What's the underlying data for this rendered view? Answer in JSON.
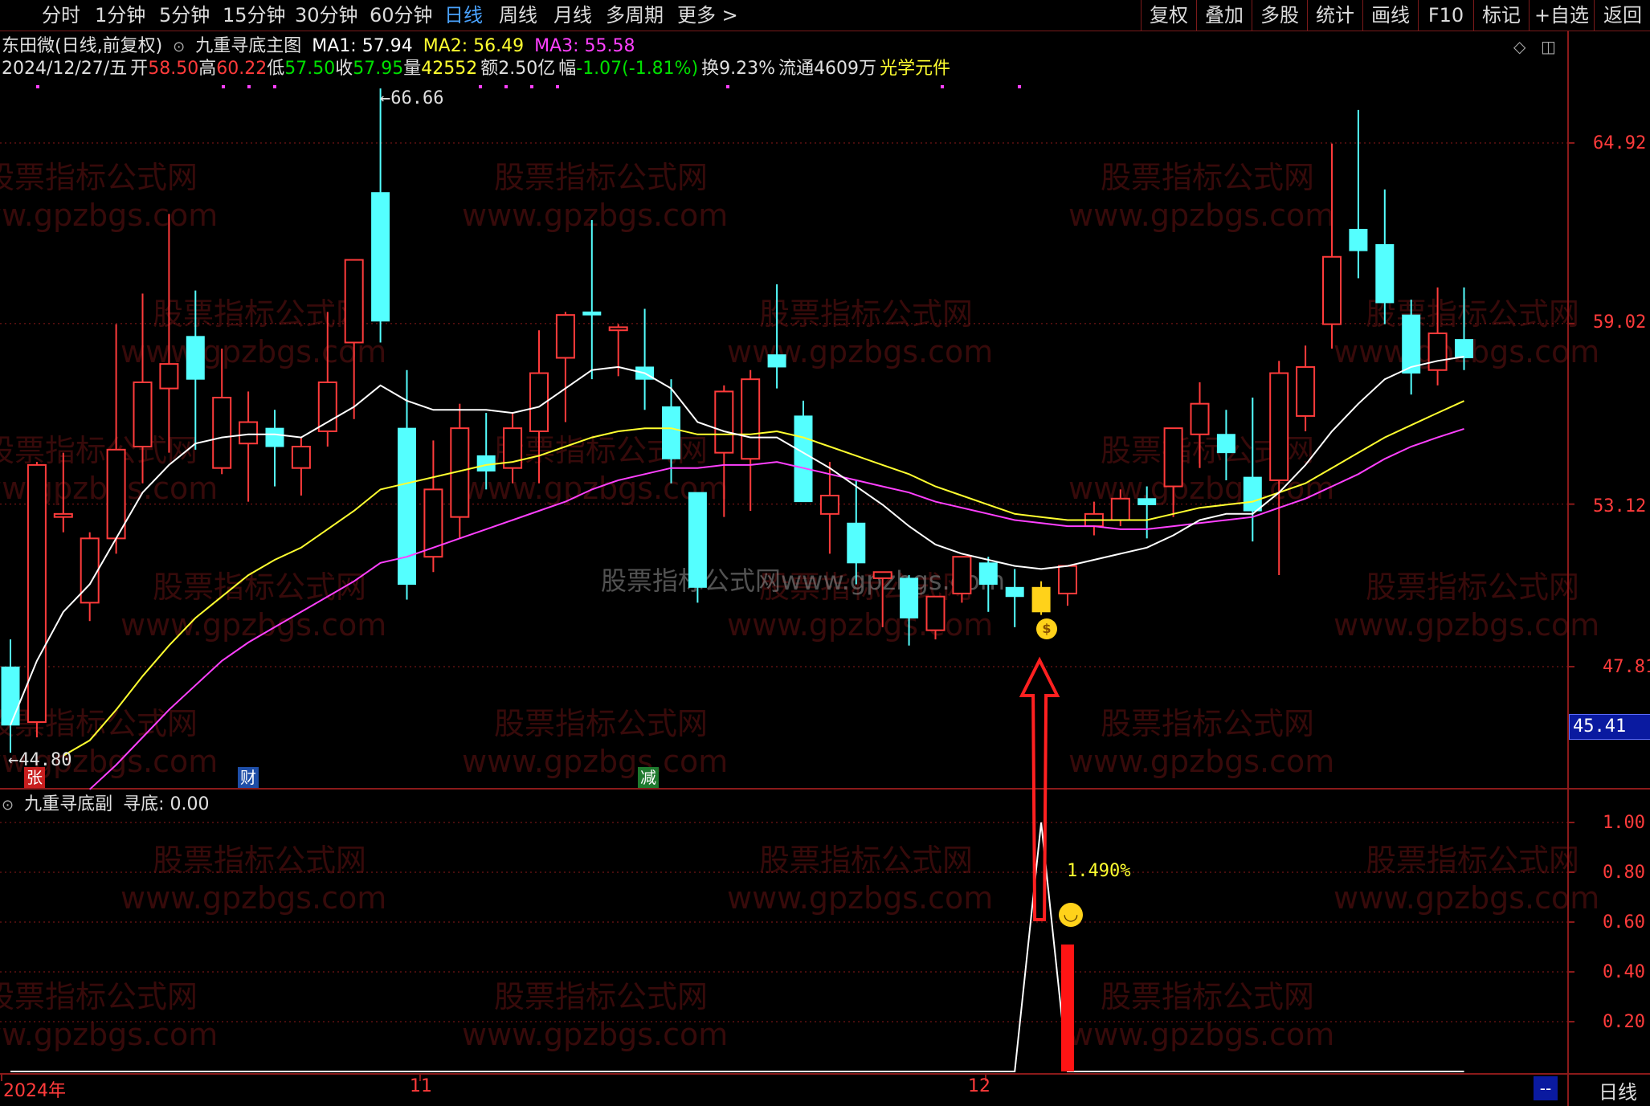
{
  "toolbar": {
    "periods": [
      "分时",
      "1分钟",
      "5分钟",
      "15分钟",
      "30分钟",
      "60分钟",
      "日线",
      "周线",
      "月线",
      "多周期",
      "更多 >"
    ],
    "active_period": "日线",
    "right_buttons": [
      "复权",
      "叠加",
      "多股",
      "统计",
      "画线",
      "F10",
      "标记",
      "+自选",
      "返回"
    ]
  },
  "main_header": {
    "stock": "东田微(日线,前复权)",
    "indicator": "九重寻底主图",
    "ma1": "MA1: 57.94",
    "ma2": "MA2: 56.49",
    "ma3": "MA3: 55.58"
  },
  "quote_line": {
    "date": "2024/12/27/五",
    "open_label": "开",
    "open": "58.50",
    "high_label": "高",
    "high": "60.22",
    "low_label": "低",
    "low": "57.50",
    "close_label": "收",
    "close": "57.95",
    "volume_label": "量",
    "volume": "42552",
    "amount": "额2.50亿",
    "change_label": "幅",
    "change": "-1.07(-1.81%)",
    "turnover": "换9.23%",
    "float_shares": "流通4609万",
    "concept": "光学元件"
  },
  "price_axis": [
    "64.92",
    "59.02",
    "53.12",
    "47.81"
  ],
  "current_price_tag": "45.41",
  "high_marker": "66.66",
  "low_marker": "44.80",
  "event_tags": [
    {
      "text": "张",
      "color": "#c81e1e"
    },
    {
      "text": "财",
      "color": "#1e4ea8"
    },
    {
      "text": "减",
      "color": "#1e7a2e"
    }
  ],
  "sub_header": {
    "indicator": "九重寻底副",
    "value": "寻底: 0.00"
  },
  "sub_axis": [
    "1.00",
    "0.80",
    "0.60",
    "0.40",
    "0.20"
  ],
  "signal_percent": "1.490%",
  "date_axis": [
    "2024年",
    "11",
    "12"
  ],
  "period_label": "日线",
  "scroll_label": "--",
  "watermarks": {
    "cn": "股票指标公式网",
    "url": "www.gpzbgs.com",
    "center": "股票指标公式网www.gpzbgs.com"
  },
  "colors": {
    "up": "#ff3b3b",
    "down": "#54ffff",
    "ma1": "#ffffff",
    "ma2": "#ffff30",
    "ma3": "#ff40ff",
    "grid": "#8b1a1a",
    "signal": "#ff1414",
    "arrow": "#ff2020"
  },
  "chart_data": {
    "type": "candlestick",
    "price_axis_ticks": [
      64.92,
      59.02,
      53.12,
      47.81
    ],
    "extremes": {
      "high": 66.66,
      "low": 44.8
    },
    "candles": [
      {
        "o": 47.8,
        "h": 48.7,
        "c": 45.9,
        "l": 45.0
      },
      {
        "o": 46.0,
        "h": 54.5,
        "c": 54.4,
        "l": 45.5
      },
      {
        "o": 52.7,
        "h": 54.8,
        "c": 52.8,
        "l": 52.2
      },
      {
        "o": 49.9,
        "h": 52.2,
        "c": 52.0,
        "l": 49.3
      },
      {
        "o": 52.0,
        "h": 59.0,
        "c": 54.9,
        "l": 51.5
      },
      {
        "o": 55.0,
        "h": 60.0,
        "c": 57.1,
        "l": 53.8
      },
      {
        "o": 56.9,
        "h": 62.6,
        "c": 57.7,
        "l": 54.8
      },
      {
        "o": 58.6,
        "h": 60.1,
        "c": 57.2,
        "l": 54.9
      },
      {
        "o": 54.3,
        "h": 58.2,
        "c": 56.6,
        "l": 54.1
      },
      {
        "o": 55.1,
        "h": 56.8,
        "c": 55.8,
        "l": 53.2
      },
      {
        "o": 55.6,
        "h": 56.2,
        "c": 55.0,
        "l": 53.7
      },
      {
        "o": 54.3,
        "h": 55.3,
        "c": 55.0,
        "l": 53.4
      },
      {
        "o": 55.5,
        "h": 59.4,
        "c": 57.1,
        "l": 55.0
      },
      {
        "o": 58.4,
        "h": 61.0,
        "c": 61.1,
        "l": 55.9
      },
      {
        "o": 63.3,
        "h": 66.7,
        "c": 59.1,
        "l": 58.4
      },
      {
        "o": 55.6,
        "h": 57.5,
        "c": 50.5,
        "l": 50.0
      },
      {
        "o": 51.4,
        "h": 55.2,
        "c": 53.6,
        "l": 50.9
      },
      {
        "o": 52.7,
        "h": 56.4,
        "c": 55.6,
        "l": 52.0
      },
      {
        "o": 54.7,
        "h": 56.1,
        "c": 54.2,
        "l": 53.6
      },
      {
        "o": 54.3,
        "h": 56.1,
        "c": 55.6,
        "l": 53.8
      },
      {
        "o": 55.5,
        "h": 58.8,
        "c": 57.4,
        "l": 53.8
      },
      {
        "o": 57.9,
        "h": 59.4,
        "c": 59.3,
        "l": 55.8
      },
      {
        "o": 59.4,
        "h": 62.4,
        "c": 59.3,
        "l": 57.2
      },
      {
        "o": 58.8,
        "h": 59.0,
        "c": 58.9,
        "l": 57.3
      },
      {
        "o": 57.6,
        "h": 59.5,
        "c": 57.2,
        "l": 56.2
      },
      {
        "o": 56.3,
        "h": 57.2,
        "c": 54.6,
        "l": 53.8
      },
      {
        "o": 53.5,
        "h": 53.5,
        "c": 50.4,
        "l": 49.9
      },
      {
        "o": 54.8,
        "h": 57.0,
        "c": 56.8,
        "l": 52.7
      },
      {
        "o": 54.6,
        "h": 57.5,
        "c": 57.2,
        "l": 52.9
      },
      {
        "o": 58.0,
        "h": 60.3,
        "c": 57.6,
        "l": 56.9
      },
      {
        "o": 56.0,
        "h": 56.5,
        "c": 53.2,
        "l": 53.2
      },
      {
        "o": 52.8,
        "h": 54.5,
        "c": 53.4,
        "l": 51.5
      },
      {
        "o": 52.5,
        "h": 53.9,
        "c": 51.2,
        "l": 50.5
      },
      {
        "o": 50.7,
        "h": 50.7,
        "c": 50.9,
        "l": 49.1
      },
      {
        "o": 50.7,
        "h": 50.8,
        "c": 49.4,
        "l": 48.5
      },
      {
        "o": 49.0,
        "h": 50.0,
        "c": 50.1,
        "l": 48.7
      },
      {
        "o": 50.2,
        "h": 51.4,
        "c": 51.4,
        "l": 49.9
      },
      {
        "o": 51.2,
        "h": 51.4,
        "c": 50.5,
        "l": 49.6
      },
      {
        "o": 50.4,
        "h": 51.0,
        "c": 50.1,
        "l": 49.1
      },
      {
        "o": 49.6,
        "h": 50.6,
        "c": 50.4,
        "l": 49.5
      },
      {
        "o": 50.2,
        "h": 51.1,
        "c": 51.1,
        "l": 49.8
      },
      {
        "o": 52.4,
        "h": 53.2,
        "c": 52.8,
        "l": 52.1
      },
      {
        "o": 52.6,
        "h": 53.6,
        "c": 53.3,
        "l": 52.4
      },
      {
        "o": 53.3,
        "h": 53.7,
        "c": 53.1,
        "l": 52.0
      },
      {
        "o": 53.7,
        "h": 55.4,
        "c": 55.6,
        "l": 52.7
      },
      {
        "o": 55.4,
        "h": 57.1,
        "c": 56.4,
        "l": 54.3
      },
      {
        "o": 55.4,
        "h": 56.2,
        "c": 54.8,
        "l": 53.9
      },
      {
        "o": 54.0,
        "h": 56.6,
        "c": 52.9,
        "l": 51.9
      },
      {
        "o": 53.9,
        "h": 57.8,
        "c": 57.4,
        "l": 50.8
      },
      {
        "o": 56.0,
        "h": 58.3,
        "c": 57.6,
        "l": 55.5
      },
      {
        "o": 59.0,
        "h": 64.9,
        "c": 61.2,
        "l": 58.2
      },
      {
        "o": 62.1,
        "h": 66.0,
        "c": 61.4,
        "l": 60.5
      },
      {
        "o": 61.6,
        "h": 63.4,
        "c": 59.7,
        "l": 59.0
      },
      {
        "o": 59.3,
        "h": 59.8,
        "c": 57.4,
        "l": 56.7
      },
      {
        "o": 57.5,
        "h": 60.2,
        "c": 58.7,
        "l": 57.0
      },
      {
        "o": 58.5,
        "h": 60.2,
        "c": 57.9,
        "l": 57.5
      }
    ],
    "signal_candle_index": 39,
    "ma1": [
      45.9,
      48.0,
      49.6,
      50.5,
      52.0,
      53.5,
      54.4,
      55.1,
      55.3,
      55.4,
      55.4,
      55.3,
      55.8,
      56.3,
      57.0,
      56.5,
      56.2,
      56.2,
      56.2,
      56.1,
      56.3,
      56.9,
      57.5,
      57.6,
      57.4,
      56.9,
      55.8,
      55.5,
      55.3,
      55.3,
      54.8,
      54.3,
      53.7,
      53.1,
      52.4,
      51.8,
      51.5,
      51.3,
      51.1,
      51.0,
      51.1,
      51.3,
      51.5,
      51.7,
      52.1,
      52.6,
      52.8,
      52.8,
      53.5,
      54.4,
      55.5,
      56.4,
      57.2,
      57.6,
      57.8,
      57.94
    ],
    "ma2": [
      null,
      null,
      44.9,
      45.4,
      46.4,
      47.5,
      48.5,
      49.4,
      50.1,
      50.8,
      51.3,
      51.7,
      52.3,
      52.9,
      53.6,
      53.8,
      54.0,
      54.2,
      54.4,
      54.5,
      54.7,
      55.0,
      55.3,
      55.5,
      55.6,
      55.6,
      55.4,
      55.4,
      55.4,
      55.5,
      55.3,
      55.0,
      54.7,
      54.4,
      54.1,
      53.7,
      53.4,
      53.1,
      52.8,
      52.7,
      52.6,
      52.6,
      52.6,
      52.6,
      52.8,
      53.0,
      53.1,
      53.2,
      53.5,
      53.8,
      54.3,
      54.8,
      55.3,
      55.7,
      56.1,
      56.49
    ],
    "ma3": [
      null,
      null,
      null,
      43.8,
      44.6,
      45.5,
      46.4,
      47.2,
      48.0,
      48.6,
      49.1,
      49.6,
      50.1,
      50.6,
      51.2,
      51.4,
      51.7,
      52.0,
      52.3,
      52.6,
      52.9,
      53.2,
      53.6,
      53.9,
      54.1,
      54.3,
      54.3,
      54.4,
      54.4,
      54.5,
      54.3,
      54.1,
      53.9,
      53.7,
      53.5,
      53.2,
      53.0,
      52.8,
      52.6,
      52.5,
      52.4,
      52.4,
      52.3,
      52.3,
      52.4,
      52.5,
      52.6,
      52.7,
      53.0,
      53.3,
      53.7,
      54.1,
      54.6,
      55.0,
      55.3,
      55.58
    ],
    "sub_chart": {
      "indicator": "寻底",
      "ticks": [
        1.0,
        0.8,
        0.6,
        0.4,
        0.2
      ],
      "line": [
        0,
        0,
        0,
        0,
        0,
        0,
        0,
        0,
        0,
        0,
        0,
        0,
        0,
        0,
        0,
        0,
        0,
        0,
        0,
        0,
        0,
        0,
        0,
        0,
        0,
        0,
        0,
        0,
        0,
        0,
        0,
        0,
        0,
        0,
        0,
        0,
        0,
        0,
        0.0,
        1.0,
        0.0,
        0,
        0,
        0,
        0,
        0,
        0,
        0,
        0,
        0,
        0,
        0,
        0,
        0,
        0,
        0
      ],
      "bar_index": 40,
      "bar_value": 0.51
    },
    "date_labels": [
      "2024年",
      "11",
      "12"
    ]
  }
}
